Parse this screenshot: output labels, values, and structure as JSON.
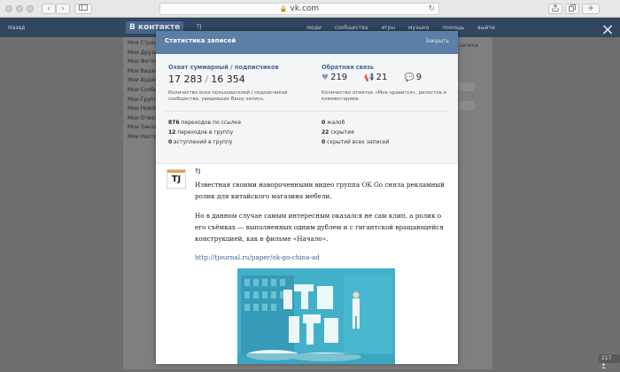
{
  "browser": {
    "url": "vk.com",
    "back_label": "‹",
    "forward_label": "›",
    "lock_icon": "🔒",
    "reload_icon": "↻"
  },
  "vk": {
    "logo": "В контакте",
    "back_link": "Назад",
    "header_tj": "TJ",
    "nav": [
      "люди",
      "сообщества",
      "игры",
      "музыка",
      "помощь",
      "выйти"
    ],
    "left_menu": [
      "Моя Страни",
      "Мои Друзья",
      "Мои Фотогр",
      "Мои Видеоз",
      "Мои Аудиоз",
      "Мои Сообщ",
      "Мои Группы",
      "Мои Новост",
      "Мои Ответы",
      "Мои Заклад",
      "Мои Настро"
    ],
    "right_text": "записи",
    "view_count": "217",
    "close_icon": "×"
  },
  "modal": {
    "title": "Статистика записей",
    "close_label": "Закрыть",
    "reach": {
      "label": "Охват суммарный / подписчиков",
      "total": "17 283",
      "separator": "/",
      "subscribers": "16 354",
      "description": "Количество всех пользователей / подписчиков сообщества, увидевших Вашу запись."
    },
    "feedback": {
      "label": "Обратная связь",
      "likes": "219",
      "reposts": "21",
      "comments": "9",
      "description": "Количество отметок «Мне нравится», репостов и комментариев."
    },
    "stats_left": [
      {
        "value": "876",
        "text": "переходов по ссылке"
      },
      {
        "value": "12",
        "text": "переходов в группу"
      },
      {
        "value": "0",
        "text": "вступлений в группу"
      }
    ],
    "stats_right": [
      {
        "value": "0",
        "text": "жалоб"
      },
      {
        "value": "22",
        "text": "скрытия"
      },
      {
        "value": "0",
        "text": "скрытий всех записей"
      }
    ]
  },
  "post": {
    "avatar_text": "TJ",
    "author": "TJ",
    "paragraph1": "Известная своими навороченными видео группа OK Go сняла рекламный ролик для китайского магазина мебели.",
    "paragraph2": "Но в данном случае самым интересным оказался не сам клип, а ролик о его съёмках — выполненных одним дублем и с гигантской вращающейся конструкцией, как в фильме «Начало».",
    "link": "http://tjournal.ru/paper/ok-go-china-ad"
  },
  "colors": {
    "modal_header": "#5b7fa6",
    "accent_text": "#4a6a8f",
    "vk_header": "#32465f"
  }
}
